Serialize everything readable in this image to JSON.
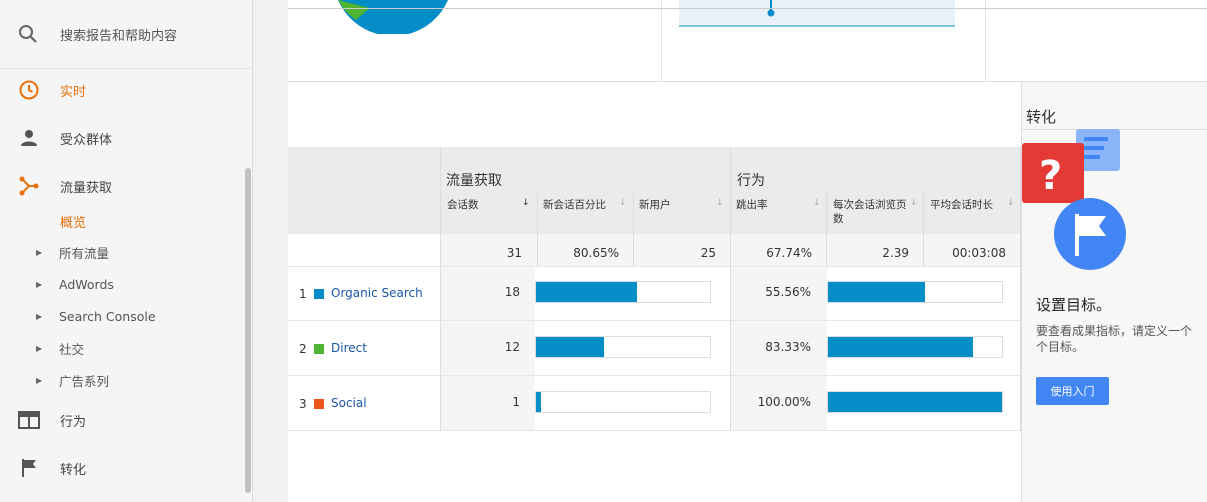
{
  "sidebar": {
    "search_label": "搜索报告和帮助内容",
    "nav": [
      {
        "label": "实时",
        "icon": "clock-icon"
      },
      {
        "label": "受众群体",
        "icon": "person-icon"
      },
      {
        "label": "流量获取",
        "icon": "acquisition-icon"
      }
    ],
    "current_sub": "概览",
    "subitems": [
      "所有流量",
      "AdWords",
      "Search Console",
      "社交",
      "广告系列"
    ],
    "bottom": [
      {
        "label": "行为",
        "icon": "behavior-icon"
      },
      {
        "label": "转化",
        "icon": "flag-icon"
      }
    ]
  },
  "table": {
    "group_acquisition": "流量获取",
    "group_behavior": "行为",
    "columns": [
      "会话数",
      "新会话百分比",
      "新用户",
      "跳出率",
      "每次会话浏览页数",
      "平均会话时长"
    ],
    "totals": {
      "sessions": "31",
      "new_pct": "80.65%",
      "new_users": "25",
      "bounce": "67.74%",
      "pages": "2.39",
      "duration": "00:03:08"
    },
    "rows": [
      {
        "index": "1",
        "source": "Organic Search",
        "color": "#058dc7",
        "sessions": "18",
        "sessions_fraction": 0.58,
        "bounce": "55.56%",
        "bounce_fraction": 0.5556
      },
      {
        "index": "2",
        "source": "Direct",
        "color": "#50b432",
        "sessions": "12",
        "sessions_fraction": 0.39,
        "bounce": "83.33%",
        "bounce_fraction": 0.8333
      },
      {
        "index": "3",
        "source": "Social",
        "color": "#ed561b",
        "sessions": "1",
        "sessions_fraction": 0.03,
        "bounce": "100.00%",
        "bounce_fraction": 1.0
      }
    ]
  },
  "conversion": {
    "title": "转化",
    "heading": "设置目标。",
    "desc": "要查看成果指标，请定义一个\n个目标。",
    "button": "使用入门"
  }
}
